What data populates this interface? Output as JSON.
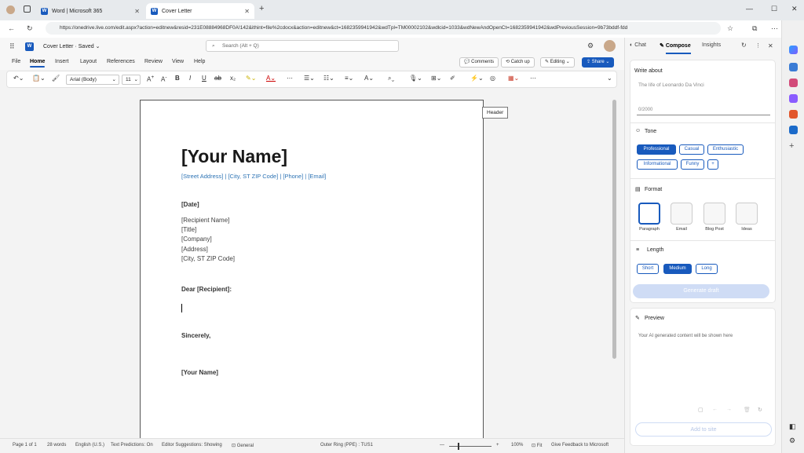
{
  "browser": {
    "tabs": [
      {
        "label": "Word | Microsoft 365"
      },
      {
        "label": "Cover Letter"
      }
    ],
    "url": "https://onedrive.live.com/edit.aspx?action=editnew&resid=231E08884968DF0A!142&ithint=file%2cdocx&action=editnew&ct=1682359941942&wdTpl=TM00002102&wdlcid=1033&wdNewAndOpenCt=1682359941942&wdPreviousSession=9b73bddf-fdd"
  },
  "office": {
    "doc_title": "Cover Letter",
    "saved_status": "Saved",
    "search_placeholder": "Search (Alt + Q)"
  },
  "ribbon": {
    "tabs": [
      "File",
      "Home",
      "Insert",
      "Layout",
      "References",
      "Review",
      "View",
      "Help"
    ],
    "comments": "Comments",
    "catchup": "Catch up",
    "editing": "Editing",
    "share": "Share"
  },
  "toolbar": {
    "font": "Arial (Body)",
    "size": "11"
  },
  "document": {
    "name": "[Your Name]",
    "address_line": "[Street Address] | [City, ST ZIP Code] | [Phone] | [Email]",
    "date": "[Date]",
    "recipient": [
      "[Recipient Name]",
      "[Title]",
      "[Company]",
      "[Address]",
      "[City, ST ZIP Code]"
    ],
    "salutation": "Dear [Recipient]:",
    "closing": "Sincerely,",
    "signature": "[Your Name]",
    "header_tag": "Header"
  },
  "status": {
    "page": "Page 1 of 1",
    "words": "28 words",
    "language": "English (U.S.)",
    "predictions": "Text Predictions: On",
    "suggestions": "Editor Suggestions: Showing",
    "sensitivity": "General",
    "ring": "Outer Ring (PPE) : TUS1",
    "zoom": "100%",
    "fit": "Fit",
    "feedback": "Give Feedback to Microsoft"
  },
  "copilot": {
    "tabs": [
      "Chat",
      "Compose",
      "Insights"
    ],
    "write_about_label": "Write about",
    "write_about_placeholder": "The life of Leonardo Da Vinci",
    "char_count": "0/2000",
    "tone_label": "Tone",
    "tones": [
      "Professional",
      "Casual",
      "Enthusiastic",
      "Informational",
      "Funny"
    ],
    "format_label": "Format",
    "formats": [
      "Paragraph",
      "Email",
      "Blog Post",
      "Ideas"
    ],
    "length_label": "Length",
    "lengths": [
      "Short",
      "Medium",
      "Long"
    ],
    "generate": "Generate draft",
    "preview_label": "Preview",
    "preview_text": "Your AI generated content will be shown here",
    "add_to_site": "Add to site"
  },
  "colors": {
    "accent": "#185abd",
    "link": "#2e74b5"
  }
}
